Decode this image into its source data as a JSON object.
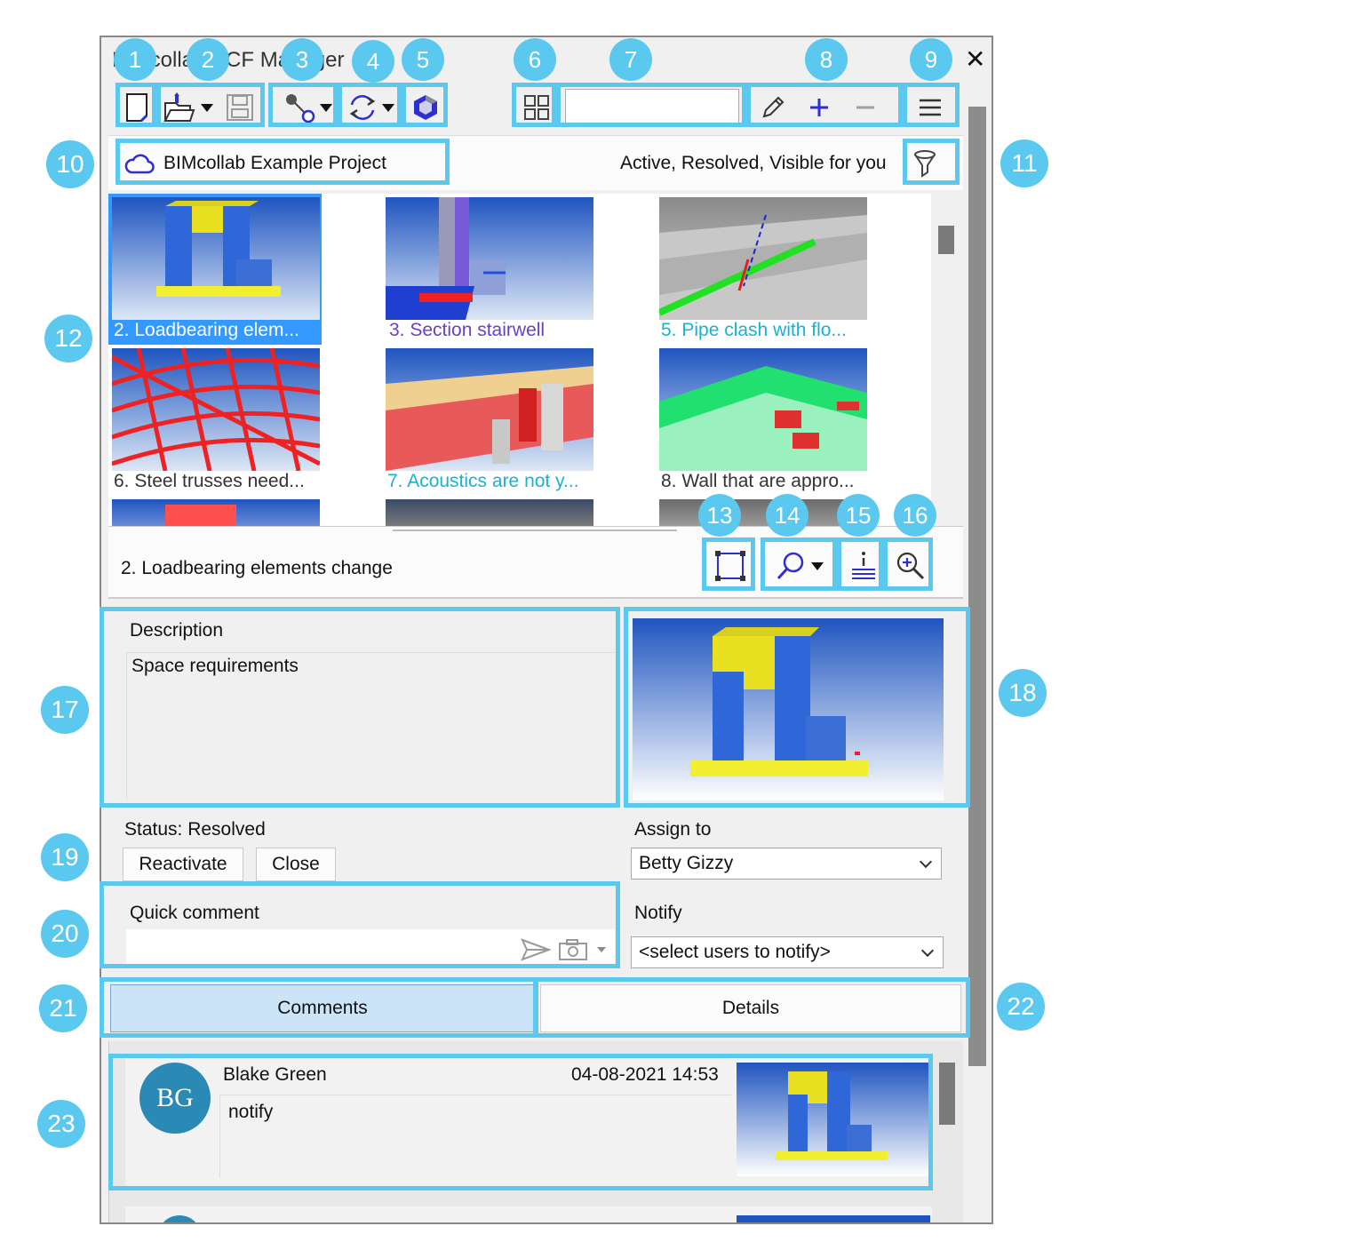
{
  "window": {
    "title": "BIMcollab BCF Manager",
    "close_symbol": "✕"
  },
  "toolbar": {
    "search_value": "",
    "hamburger_symbol": "≡"
  },
  "project": {
    "name": "BIMcollab Example Project",
    "filter_text": "Active, Resolved, Visible for you"
  },
  "issues": [
    {
      "title": "2. Loadbearing elem...",
      "color": "#ffffff",
      "selected": true
    },
    {
      "title": "3. Section stairwell",
      "color": "#6a3fc8",
      "selected": false
    },
    {
      "title": "5. Pipe clash with flo...",
      "color": "#17b2d4",
      "selected": false
    },
    {
      "title": "6. Steel trusses need...",
      "color": "#333333",
      "selected": false
    },
    {
      "title": "7. Acoustics are not y...",
      "color": "#17b2d4",
      "selected": false
    },
    {
      "title": "8. Wall that are appro...",
      "color": "#333333",
      "selected": false
    }
  ],
  "selected_issue": {
    "title": "2. Loadbearing elements change"
  },
  "description": {
    "label": "Description",
    "text": "Space requirements"
  },
  "status": {
    "label": "Status: Resolved",
    "reactivate_label": "Reactivate",
    "close_label": "Close"
  },
  "assign": {
    "label": "Assign to",
    "value": "Betty Gizzy"
  },
  "notify": {
    "label": "Notify",
    "value": "<select users to notify>"
  },
  "quick_comment": {
    "label": "Quick comment",
    "value": ""
  },
  "tabs": {
    "comments": "Comments",
    "details": "Details"
  },
  "comments": [
    {
      "initials": "BG",
      "author": "Blake Green",
      "date": "04-08-2021 14:53",
      "text": "notify"
    }
  ],
  "badges": [
    "1",
    "2",
    "3",
    "4",
    "5",
    "6",
    "7",
    "8",
    "9",
    "10",
    "11",
    "12",
    "13",
    "14",
    "15",
    "16",
    "17",
    "18",
    "19",
    "20",
    "21",
    "22",
    "23"
  ],
  "colors": {
    "highlight": "#5bc8ef",
    "selection": "#3399ff",
    "accent": "#2f2fd0"
  }
}
